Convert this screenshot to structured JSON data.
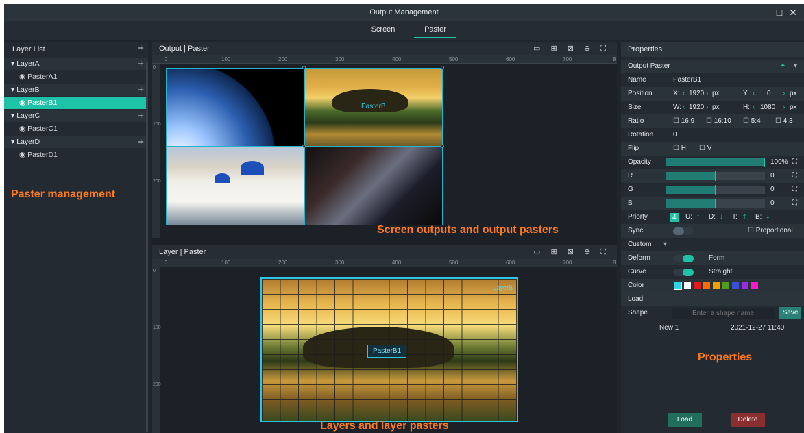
{
  "window": {
    "title": "Output Management",
    "maximize_icon": "□",
    "close_icon": "✕"
  },
  "tabs": [
    {
      "label": "Screen"
    },
    {
      "label": "Paster"
    }
  ],
  "layer_list": {
    "title": "Layer List",
    "add_icon": "+",
    "layers": [
      {
        "label": "LayerA",
        "pasters": [
          "PasterA1"
        ]
      },
      {
        "label": "LayerB",
        "pasters": [
          "PasterB1"
        ]
      },
      {
        "label": "LayerC",
        "pasters": [
          "PasterC1"
        ]
      },
      {
        "label": "LayerD",
        "pasters": [
          "PasterD1"
        ]
      }
    ],
    "selected_paster": "PasterB1",
    "arrow": "▾",
    "eye_icon": "◉"
  },
  "annotations": {
    "left": "Paster management",
    "center_top": "Screen outputs and output pasters",
    "center_bottom": "Layers and layer pasters",
    "right": "Properties"
  },
  "output_view": {
    "title": "Output | Paster",
    "tool_icons": "▭ ⊞ ⊠ ⊕ ⛶",
    "ruler_ticks": [
      "0",
      "100",
      "200",
      "300",
      "400",
      "500",
      "600",
      "700",
      "8"
    ],
    "vruler_ticks": [
      "0",
      "100",
      "200"
    ],
    "paster_label": "PasterB"
  },
  "layer_view": {
    "title": "Layer | Paster",
    "tool_icons": "▭ ⊞ ⊠ ⊕ ⛶",
    "ruler_ticks": [
      "0",
      "100",
      "200",
      "300",
      "400",
      "500",
      "600",
      "700",
      "8"
    ],
    "vruler_ticks": [
      "0",
      "100",
      "200"
    ],
    "layer_tag": "LayerB",
    "paster_label": "PasterB1"
  },
  "properties": {
    "title": "Properties",
    "section": "Output Paster",
    "pin_icon": "✦",
    "name_label": "Name",
    "name_value": "PasterB1",
    "position_label": "Position",
    "pos_x_label": "X:",
    "pos_x": "1920",
    "pos_y_label": "Y:",
    "pos_y": "0",
    "unit": "px",
    "size_label": "Size",
    "size_w_label": "W:",
    "size_w": "1920",
    "size_h_label": "H:",
    "size_h": "1080",
    "ratio_label": "Ratio",
    "ratios": [
      "16:9",
      "16:10",
      "5:4",
      "4:3"
    ],
    "rotation_label": "Rotation",
    "rotation_value": "0",
    "flip_label": "Flip",
    "flip_h": "H",
    "flip_v": "V",
    "opacity_label": "Opacity",
    "opacity_value": "100%",
    "opacity_fraction": 1.0,
    "r_label": "R",
    "r_value": "0",
    "g_label": "G",
    "g_value": "0",
    "b_label": "B",
    "b_value": "0",
    "priority_label": "Priorty",
    "priority_value": "4",
    "priority_u": "U:",
    "priority_d": "D:",
    "priority_t": "T:",
    "priority_b": "B:",
    "sync_label": "Sync",
    "proportional_label": "Proportional",
    "custom_label": "Custom",
    "deform_label": "Deform",
    "deform_value": "Form",
    "curve_label": "Curve",
    "curve_value": "Straight",
    "color_label": "Color",
    "colors": [
      "#2fd3e6",
      "#ffffff",
      "#e01b1b",
      "#ff6a00",
      "#f2a200",
      "#4f9d1a",
      "#3a4fd6",
      "#9a2be0",
      "#ff17d2"
    ],
    "load_label": "Load",
    "shape_label": "Shape",
    "shape_placeholder": "Enter a shape name",
    "save_label": "Save",
    "shape_entry_name": "New 1",
    "shape_entry_time": "2021-12-27 11:40",
    "load_button": "Load",
    "delete_button": "Delete"
  }
}
